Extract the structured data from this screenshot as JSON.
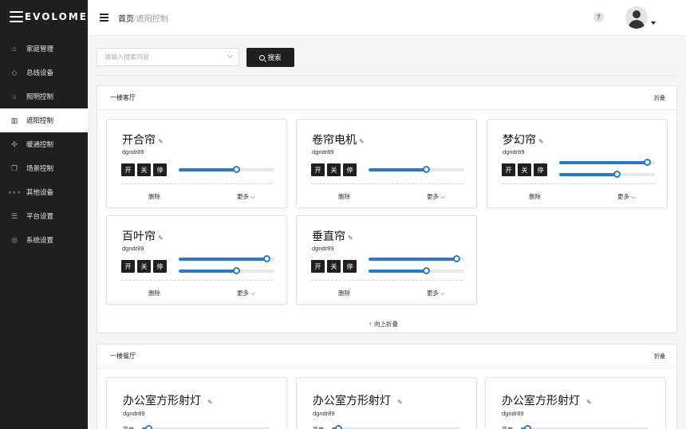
{
  "brand": {
    "name": "EVOLOME"
  },
  "sidebar": {
    "items": [
      {
        "label": "家庭管理",
        "icon": "home-icon"
      },
      {
        "label": "总线设备",
        "icon": "cube-icon"
      },
      {
        "label": "照明控制",
        "icon": "sun-icon"
      },
      {
        "label": "遮阳控制",
        "icon": "curtain-icon",
        "active": true
      },
      {
        "label": "暖通控制",
        "icon": "fan-icon"
      },
      {
        "label": "场景控制",
        "icon": "scene-icon"
      },
      {
        "label": "其他设备",
        "icon": "dots-icon"
      },
      {
        "label": "平台设置",
        "icon": "list-icon"
      },
      {
        "label": "系统设置",
        "icon": "settings-icon"
      }
    ]
  },
  "header": {
    "breadcrumb_home": "首页",
    "breadcrumb_sep": "/",
    "breadcrumb_current": "遮阳控制",
    "help": "?"
  },
  "search": {
    "placeholder": "请输入搜索内容",
    "button_label": "搜索"
  },
  "panels": [
    {
      "title": "一楼客厅",
      "fold_label": "折叠",
      "collapse_label": "向上折叠",
      "cards": [
        {
          "title": "开合帘",
          "sub": "dgndr89",
          "btns": [
            "开",
            "关",
            "停"
          ],
          "sliders": [
            0.6
          ],
          "delete": "删除",
          "more": "更多 ⌵"
        },
        {
          "title": "卷帘电机",
          "sub": "dgndr89",
          "btns": [
            "开",
            "关",
            "停"
          ],
          "sliders": [
            0.6
          ],
          "delete": "删除",
          "more": "更多 ⌵"
        },
        {
          "title": "梦幻帘",
          "sub": "dgndr89",
          "btns": [
            "开",
            "关",
            "停"
          ],
          "sliders": [
            0.92,
            0.6
          ],
          "delete": "删除",
          "more": "更多 ⌵"
        },
        {
          "title": "百叶帘",
          "sub": "dgndr89",
          "btns": [
            "开",
            "关",
            "停"
          ],
          "sliders": [
            0.92,
            0.6
          ],
          "delete": "删除",
          "more": "更多 ⌵"
        },
        {
          "title": "垂直帘",
          "sub": "dgndr89",
          "btns": [
            "开",
            "关",
            "停"
          ],
          "sliders": [
            0.92,
            0.6
          ],
          "delete": "删除",
          "more": "更多 ⌵"
        }
      ]
    },
    {
      "title": "一楼餐厅",
      "fold_label": "折叠",
      "cards": [
        {
          "title": "办公室方形射灯",
          "sub": "dgndr89",
          "label": "亮度"
        },
        {
          "title": "办公室方形射灯",
          "sub": "dgndr89",
          "label": "亮度"
        },
        {
          "title": "办公室方形射灯",
          "sub": "dgndr89",
          "label": "亮度"
        }
      ]
    }
  ],
  "colors": {
    "sidebar_bg": "#1f1f1f",
    "accent": "#2b78cf",
    "button_bg": "#1f1f1f"
  }
}
